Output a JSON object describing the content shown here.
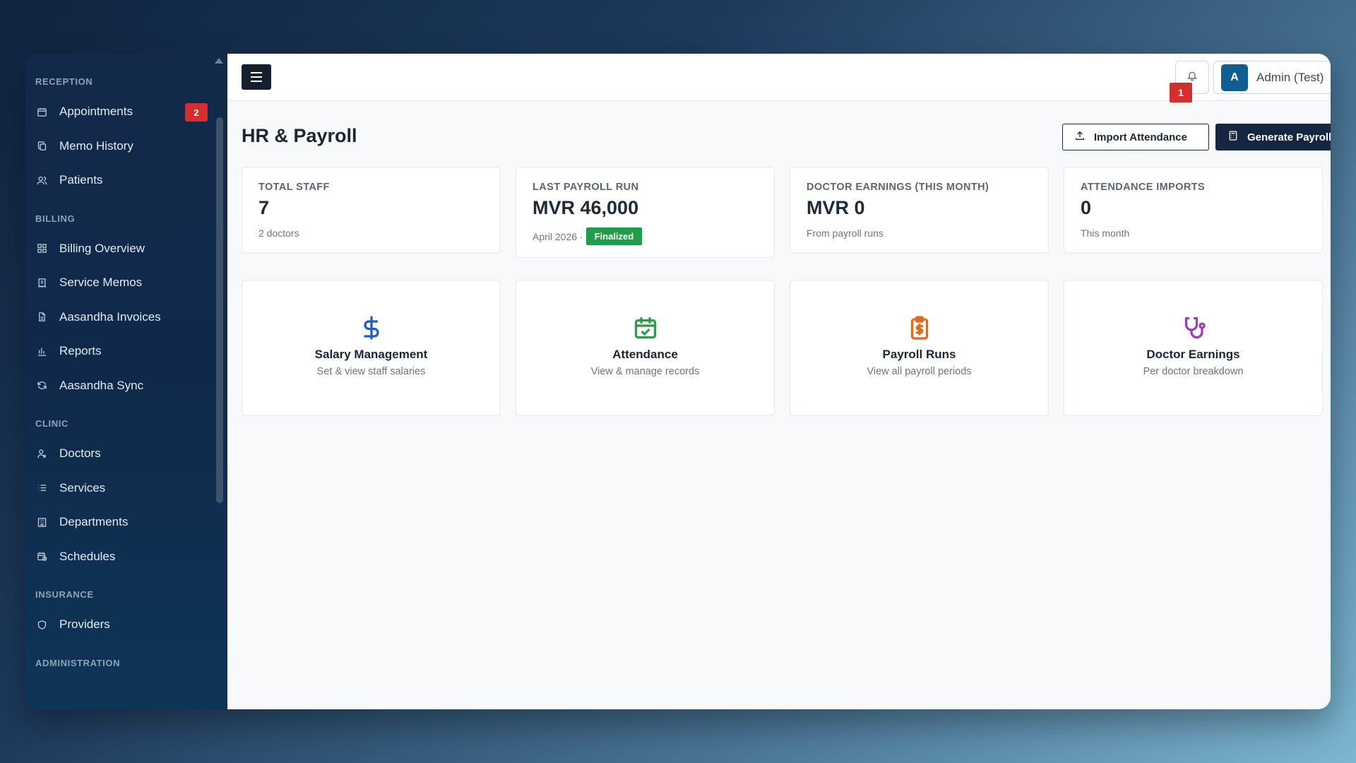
{
  "sidebar": {
    "sections": {
      "reception": "RECEPTION",
      "billing": "BILLING",
      "clinic": "CLINIC",
      "insurance": "INSURANCE",
      "administration": "ADMINISTRATION"
    },
    "items": {
      "appointments": {
        "label": "Appointments",
        "badge": "2",
        "icon": "calendar-icon"
      },
      "memo_history": {
        "label": "Memo History",
        "icon": "copy-icon"
      },
      "patients": {
        "label": "Patients",
        "icon": "users-icon"
      },
      "billing_overview": {
        "label": "Billing Overview",
        "icon": "grid-icon"
      },
      "service_memos": {
        "label": "Service Memos",
        "icon": "receipt-icon"
      },
      "aasandha_invoices": {
        "label": "Aasandha Invoices",
        "icon": "file-icon"
      },
      "reports": {
        "label": "Reports",
        "icon": "bar-chart-icon"
      },
      "aasandha_sync": {
        "label": "Aasandha Sync",
        "icon": "refresh-icon"
      },
      "doctors": {
        "label": "Doctors",
        "icon": "user-doctor-icon"
      },
      "services": {
        "label": "Services",
        "icon": "list-icon"
      },
      "departments": {
        "label": "Departments",
        "icon": "building-icon"
      },
      "schedules": {
        "label": "Schedules",
        "icon": "calendar-clock-icon"
      },
      "providers": {
        "label": "Providers",
        "icon": "shield-icon"
      }
    }
  },
  "topbar": {
    "notification_count": "1",
    "user_initial": "A",
    "user_name": "Admin (Test)"
  },
  "page": {
    "title": "HR & Payroll",
    "import_button": "Import Attendance",
    "generate_button": "Generate Payroll"
  },
  "stats": {
    "total_staff": {
      "label": "TOTAL STAFF",
      "value": "7",
      "sub": "2 doctors"
    },
    "last_payroll": {
      "label": "LAST PAYROLL RUN",
      "value": "MVR 46,000",
      "sub": "April 2026 ·",
      "status": "Finalized"
    },
    "doctor_earnings": {
      "label": "DOCTOR EARNINGS (THIS MONTH)",
      "value": "MVR 0",
      "sub": "From payroll runs"
    },
    "attendance_imports": {
      "label": "ATTENDANCE IMPORTS",
      "value": "0",
      "sub": "This month"
    }
  },
  "links": {
    "salary": {
      "title": "Salary Management",
      "sub": "Set & view staff salaries",
      "icon": "dollar-icon",
      "color": "#1f5fb8"
    },
    "attendance": {
      "title": "Attendance",
      "sub": "View & manage records",
      "icon": "calendar-check-icon",
      "color": "#2e9b48"
    },
    "payroll_runs": {
      "title": "Payroll Runs",
      "sub": "View all payroll periods",
      "icon": "clipboard-dollar-icon",
      "color": "#e06a1a"
    },
    "doctor_earnings": {
      "title": "Doctor Earnings",
      "sub": "Per doctor breakdown",
      "icon": "stethoscope-icon",
      "color": "#9b3dbd"
    }
  },
  "colors": {
    "badge_red": "#d32f2f",
    "finalized_green": "#1f9d4a",
    "primary_dark": "#142640"
  }
}
